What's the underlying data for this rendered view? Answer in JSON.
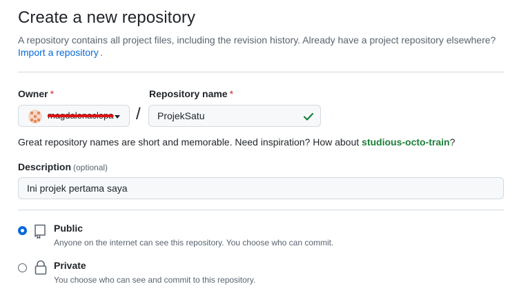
{
  "header": {
    "title": "Create a new repository",
    "description": "A repository contains all project files, including the revision history. Already have a project repository elsewhere?",
    "import_link": "Import a repository",
    "import_suffix": "."
  },
  "owner": {
    "label": "Owner",
    "required_mark": "*",
    "value": "magdalenaclepa"
  },
  "separator": "/",
  "repository_name": {
    "label": "Repository name",
    "required_mark": "*",
    "value": "ProjekSatu",
    "valid": true
  },
  "name_hint": {
    "text": "Great repository names are short and memorable. Need inspiration? How about ",
    "suggestion": "studious-octo-train",
    "suffix": "?"
  },
  "description_field": {
    "label": "Description",
    "optional": "(optional)",
    "value": "Ini projek pertama saya"
  },
  "visibility": [
    {
      "title": "Public",
      "description": "Anyone on the internet can see this repository. You choose who can commit.",
      "icon": "repo-icon",
      "selected": true
    },
    {
      "title": "Private",
      "description": "You choose who can see and commit to this repository.",
      "icon": "lock-icon",
      "selected": false
    }
  ],
  "colors": {
    "link": "#0969da",
    "success": "#1a7f37",
    "required": "#d1242f",
    "muted": "#59636e",
    "border": "#d1d9e0"
  }
}
